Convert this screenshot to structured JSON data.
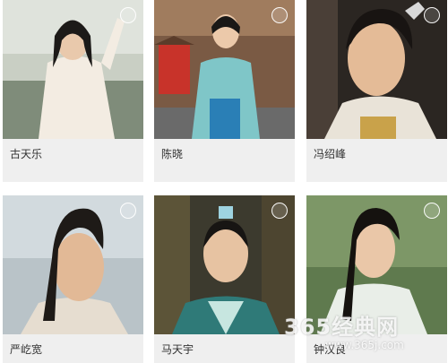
{
  "cards": [
    {
      "name": "古天乐"
    },
    {
      "name": "陈晓"
    },
    {
      "name": "冯绍峰"
    },
    {
      "name": "严屹宽"
    },
    {
      "name": "马天宇"
    },
    {
      "name": "钟汉良"
    }
  ],
  "watermark": {
    "main": "365经典网",
    "url": "www.365j.com"
  },
  "colors": {
    "caption_bg": "#efefef",
    "caption_text": "#333333"
  }
}
